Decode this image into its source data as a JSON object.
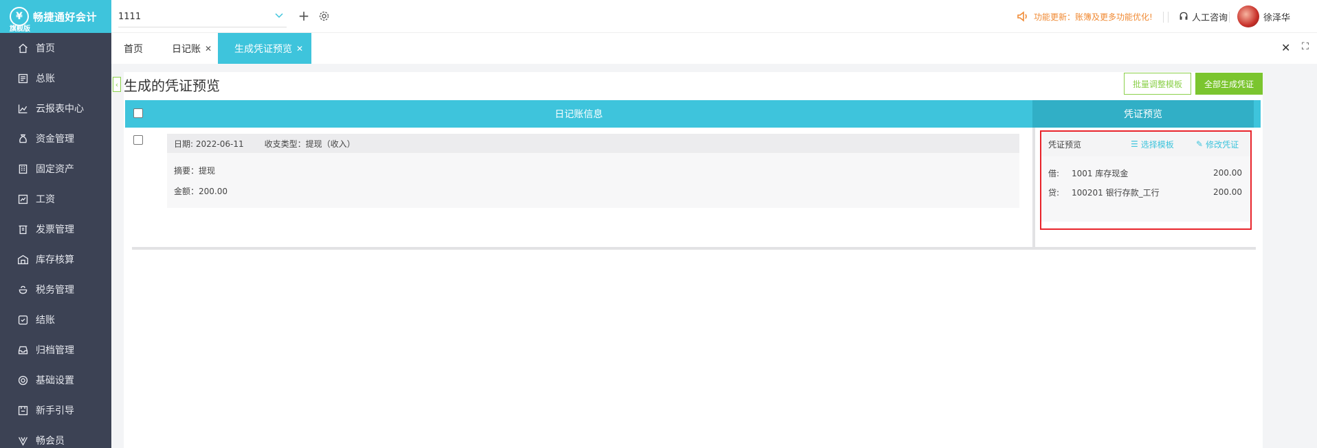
{
  "app": {
    "name": "畅捷通好会计",
    "edition": "旗舰版"
  },
  "sidebar": {
    "items": [
      {
        "label": "首页",
        "icon": "home-icon"
      },
      {
        "label": "总账",
        "icon": "ledger-icon"
      },
      {
        "label": "云报表中心",
        "icon": "chart-icon"
      },
      {
        "label": "资金管理",
        "icon": "money-bag-icon"
      },
      {
        "label": "固定资产",
        "icon": "building-icon"
      },
      {
        "label": "工资",
        "icon": "salary-icon"
      },
      {
        "label": "发票管理",
        "icon": "invoice-icon"
      },
      {
        "label": "库存核算",
        "icon": "warehouse-icon"
      },
      {
        "label": "税务管理",
        "icon": "tax-icon"
      },
      {
        "label": "结账",
        "icon": "checkout-icon"
      },
      {
        "label": "归档管理",
        "icon": "archive-icon"
      },
      {
        "label": "基础设置",
        "icon": "gear-icon"
      },
      {
        "label": "新手引导",
        "icon": "guide-icon"
      },
      {
        "label": "畅会员",
        "icon": "vip-icon"
      }
    ]
  },
  "topbar": {
    "account": "1111",
    "notice": "功能更新：账簿及更多功能优化!",
    "consult": "人工咨询",
    "user": "徐泽华"
  },
  "tabs": [
    {
      "label": "首页"
    },
    {
      "label": "日记账"
    },
    {
      "label": "生成凭证预览"
    }
  ],
  "page": {
    "title": "生成的凭证预览",
    "btn_batch_template": "批量调整模板",
    "btn_generate_all": "全部生成凭证"
  },
  "table": {
    "col_journal": "日记账信息",
    "col_voucher": "凭证预览"
  },
  "row": {
    "date": "日期: 2022-06-11",
    "type": "收支类型：提现（收入）",
    "summary": "摘要：提现",
    "amount": "金额：200.00"
  },
  "voucher": {
    "title": "凭证预览",
    "select_template": "选择模板",
    "edit_voucher": "修改凭证",
    "lines": [
      {
        "dc": "借:",
        "account": "1001 库存现金",
        "amount": "200.00"
      },
      {
        "dc": "贷:",
        "account": "100201 银行存款_工行",
        "amount": "200.00"
      }
    ]
  }
}
